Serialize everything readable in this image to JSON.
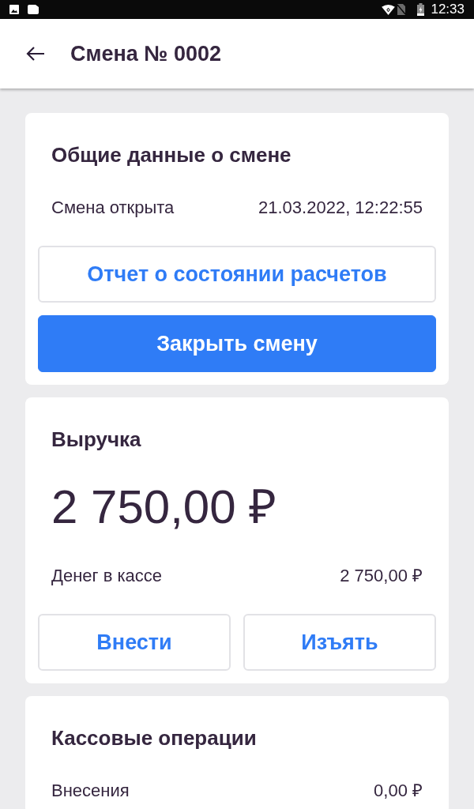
{
  "status_bar": {
    "time": "12:33"
  },
  "app_bar": {
    "title": "Смена № 0002"
  },
  "cards": [
    {
      "title": "Общие данные о смене",
      "rows": [
        {
          "label": "Смена открыта",
          "value": "21.03.2022, 12:22:55"
        }
      ],
      "button_group": {
        "kind": "column",
        "buttons": [
          {
            "label": "Отчет о состоянии расчетов",
            "kind": "outlined"
          },
          {
            "label": "Закрыть смену",
            "kind": "filled"
          }
        ]
      }
    },
    {
      "title": "Выручка",
      "amount": "2 750,00 ₽",
      "rows": [
        {
          "label": "Денег в кассе",
          "value": "2 750,00 ₽"
        }
      ],
      "button_group": {
        "kind": "row",
        "buttons": [
          {
            "label": "Внести",
            "kind": "outlined"
          },
          {
            "label": "Изъять",
            "kind": "outlined"
          }
        ]
      }
    },
    {
      "title": "Кассовые операции",
      "rows": [
        {
          "label": "Внесения",
          "value": "0,00 ₽"
        }
      ]
    }
  ]
}
